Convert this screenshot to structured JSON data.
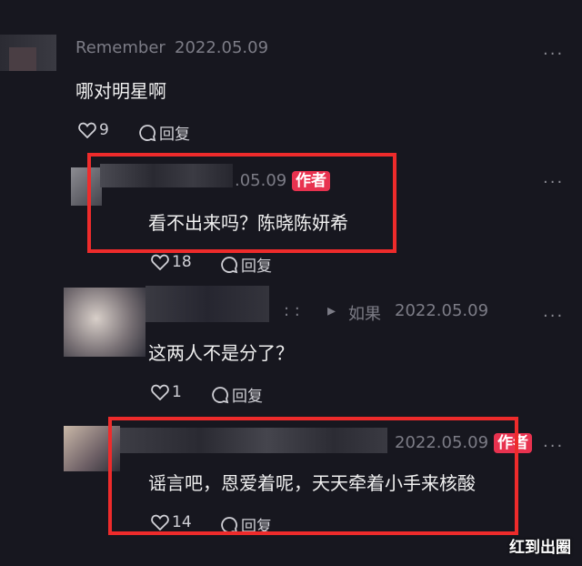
{
  "comments": [
    {
      "user": "Remember",
      "date": "2022.05.09",
      "text": "哪对明星啊",
      "likes": "9",
      "reply_label": "回复"
    },
    {
      "user": "",
      "date": ".05.09",
      "badge": "作者",
      "text": "看不出来吗？陈晓陈妍希",
      "likes": "18",
      "reply_label": "回复"
    },
    {
      "user": "",
      "reply_to": "如果",
      "date": "2022.05.09",
      "text": "这两人不是分了？",
      "likes": "1",
      "reply_label": "回复"
    },
    {
      "user": "",
      "date": "2022.05.09",
      "badge": "作者",
      "text": "谣言吧，恩爱着呢，天天牵着小手来核酸",
      "likes": "14",
      "reply_label": "回复"
    }
  ],
  "more_icon": "···",
  "reply_arrow": "▸",
  "watermark": "红到出圈",
  "colors": {
    "background": "#17171f",
    "highlight": "#ee2b2b",
    "badge": "#e8324f"
  }
}
